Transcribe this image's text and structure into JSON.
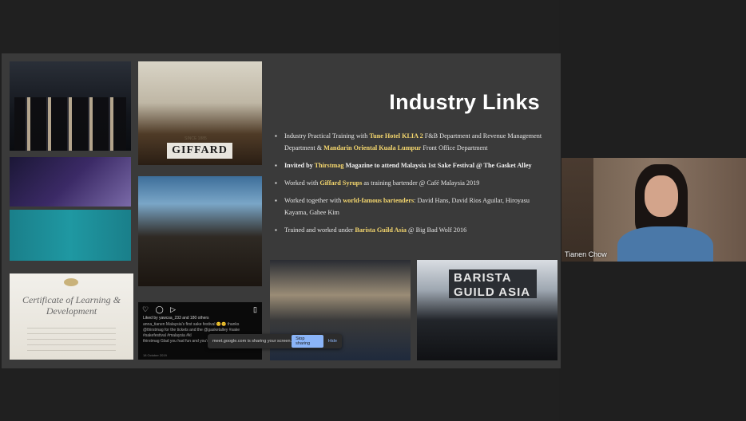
{
  "slide": {
    "title": "Industry Links",
    "bullets": [
      {
        "parts": [
          {
            "text": "Industry Practical Training with ",
            "style": "normal"
          },
          {
            "text": "Tune Hotel KLIA 2",
            "style": "highlight"
          },
          {
            "text": " F&B Department and Revenue Management Department & ",
            "style": "normal"
          },
          {
            "text": "Mandarin Oriental Kuala Lumpur",
            "style": "highlight"
          },
          {
            "text": " Front Office Department",
            "style": "normal"
          }
        ]
      },
      {
        "parts": [
          {
            "text": "Invited by ",
            "style": "bold"
          },
          {
            "text": "Thirstmag",
            "style": "highlight"
          },
          {
            "text": " Magazine to attend Malaysia 1st Sake Festival @ The Gasket Alley",
            "style": "bold"
          }
        ]
      },
      {
        "parts": [
          {
            "text": "Worked with ",
            "style": "normal"
          },
          {
            "text": "Giffard Syrups",
            "style": "highlight"
          },
          {
            "text": " as training bartender @ Café Malaysia 2019",
            "style": "normal"
          }
        ]
      },
      {
        "parts": [
          {
            "text": "Worked together with ",
            "style": "normal"
          },
          {
            "text": "world-famous bartenders",
            "style": "highlight"
          },
          {
            "text": ": David Hans, David Rios Aguilar, Hiroyasu Kayama, Gahee Kim",
            "style": "normal"
          }
        ]
      },
      {
        "parts": [
          {
            "text": "Trained and worked under ",
            "style": "normal"
          },
          {
            "text": "Barista Guild Asia",
            "style": "highlight"
          },
          {
            "text": " @ Big Bad Wolf 2016",
            "style": "normal"
          }
        ]
      }
    ],
    "photos": {
      "gifford_sign": "GIFFARD",
      "gifford_sub": "SINCE 1885",
      "certificate_title": "Certificate of Learning & Development",
      "barista_banner": "BARISTA GUILD ASIA",
      "instagram": {
        "icons": "♡ ◯ ▷",
        "bookmark": "▯",
        "liked_by": "Liked by yawcsa_233 and 180 others",
        "caption": "anna_tianen Malaysia's first sake festival 😊😊 thanks @thirstmag for the tickets and the @gasketalley #sake #sakefestival #malaysia #kl",
        "comment": "thirstmag Glad you had fun and you're most welcome!",
        "date": "18 October 2019"
      }
    }
  },
  "screen_share": {
    "message": "meet.google.com is sharing your screen.",
    "stop_label": "Stop sharing",
    "hide_label": "Hide"
  },
  "participant": {
    "name": "Tianen Chow"
  },
  "colors": {
    "highlight": "#f5d76e",
    "slide_bg": "#3a3a3a",
    "stage_bg": "#202020"
  }
}
